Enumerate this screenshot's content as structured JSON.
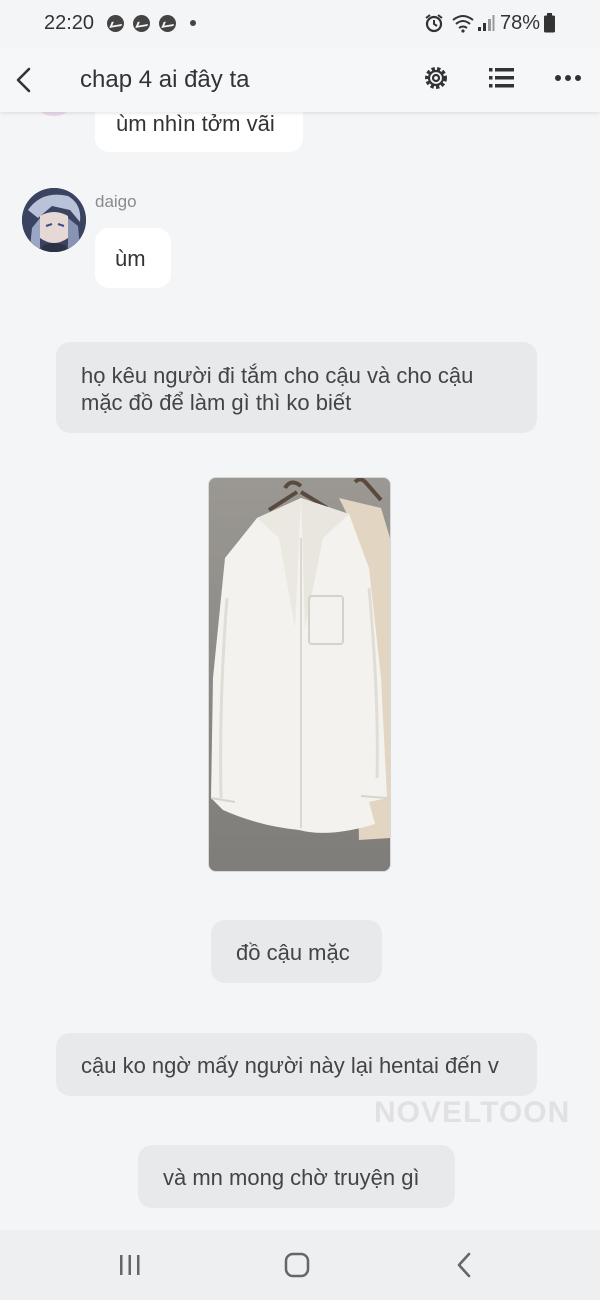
{
  "status": {
    "time": "22:20",
    "battery": "78%",
    "icons": [
      "messenger-icon",
      "messenger-icon",
      "messenger-icon",
      "dot-icon",
      "alarm-icon",
      "wifi-icon",
      "signal-icon",
      "battery-icon"
    ]
  },
  "header": {
    "title": "chap 4 ai đây ta",
    "icons": [
      "back-icon",
      "gear-icon",
      "list-icon",
      "more-icon"
    ]
  },
  "messages": {
    "m1": "ùm nhìn tởm vãi",
    "m2_user": "daigo",
    "m2": "ùm",
    "m3": "họ kêu người đi tắm cho cậu và cho cậu mặc đồ để làm gì thì ko biết",
    "m4": "đồ cậu mặc",
    "m5": "cậu ko ngờ mấy người này lại hentai đến v",
    "m6": "và mn mong chờ truyện gì"
  },
  "watermark": "NOVELTOON",
  "colors": {
    "background": "#f4f5f7",
    "bubble_white": "#ffffff",
    "bubble_grey": "#e8e9eb"
  }
}
